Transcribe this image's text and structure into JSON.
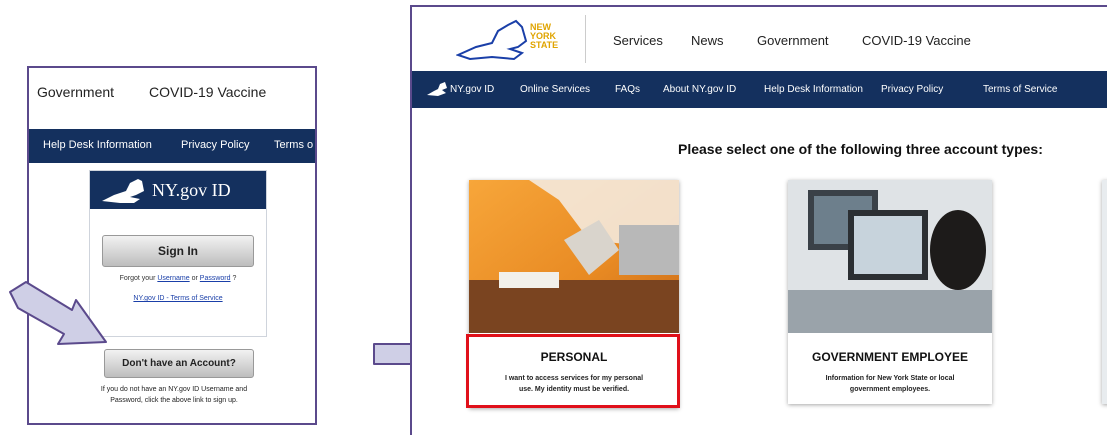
{
  "left": {
    "top_nav": [
      "Government",
      "COVID-19 Vaccine"
    ],
    "sub_nav": [
      "Help Desk Information",
      "Privacy Policy",
      "Terms o"
    ],
    "login_title": "NY.gov ID",
    "sign_in_label": "Sign In",
    "forgot_prefix": "Forgot your",
    "username_link": "Username",
    "or_text": "or",
    "password_link": "Password",
    "forgot_suffix": "?",
    "tos_link": "NY.gov ID - Terms of Service",
    "no_account_label": "Don't have an Account?",
    "signup_help_line1": "If you do not have an NY.gov ID Username and",
    "signup_help_line2": "Password, click the above link to sign up."
  },
  "right": {
    "logo_text": [
      "NEW",
      "YORK",
      "STATE"
    ],
    "top_nav": [
      "Services",
      "News",
      "Government",
      "COVID-19 Vaccine"
    ],
    "sub_nav": [
      "NY.gov ID",
      "Online Services",
      "FAQs",
      "About NY.gov ID",
      "Help Desk Information",
      "Privacy Policy",
      "Terms of Service"
    ],
    "select_title": "Please select one of the following three account types:",
    "cards": [
      {
        "title": "PERSONAL",
        "desc_line1": "I want to access services for my personal",
        "desc_line2": "use. My identity must be verified."
      },
      {
        "title": "GOVERNMENT EMPLOYEE",
        "desc_line1": "Information for New York State or local",
        "desc_line2": "government employees."
      }
    ]
  },
  "colors": {
    "navy": "#14305e",
    "highlight": "#e0101a",
    "arrow": "#cfcfe6",
    "arrow_border": "#5b4a8c"
  }
}
